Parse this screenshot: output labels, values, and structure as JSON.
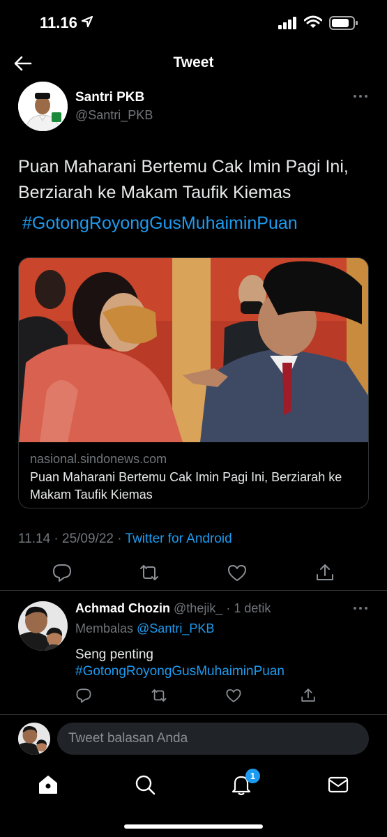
{
  "status_bar": {
    "time": "11.16",
    "icons": [
      "location-arrow-icon",
      "signal-bars-icon",
      "wifi-icon",
      "battery-icon"
    ]
  },
  "header": {
    "title": "Tweet",
    "back_icon": "arrow-left-icon"
  },
  "tweet": {
    "author_name": "Santri PKB",
    "author_handle": "@Santri_PKB",
    "text": "Puan Maharani Bertemu Cak Imin Pagi Ini, Berziarah ke Makam Taufik Kiemas",
    "hashtag": "#GotongRoyongGusMuhaiminPuan",
    "card": {
      "domain": "nasional.sindonews.com",
      "title": "Puan Maharani Bertemu Cak Imin Pagi Ini, Berziarah ke Makam Taufik Kiemas"
    },
    "timestamp": "11.14 · 25/09/22 · ",
    "source": "Twitter for Android",
    "actions": [
      "reply-icon",
      "retweet-icon",
      "like-icon",
      "share-icon"
    ]
  },
  "reply": {
    "author_name": "Achmad Chozin",
    "author_handle": "@thejik_",
    "time": " · 1 detik",
    "replying_prefix": "Membalas ",
    "replying_to": "@Santri_PKB",
    "text": "Seng penting",
    "hashtag": "#GotongRoyongGusMuhaiminPuan"
  },
  "compose": {
    "placeholder": "Tweet balasan Anda"
  },
  "tabbar": {
    "tabs": [
      "home-icon",
      "search-icon",
      "notifications-icon",
      "messages-icon"
    ],
    "notification_count": "1"
  },
  "colors": {
    "background": "#000000",
    "accent": "#1d9bf0",
    "secondary_text": "#71767b",
    "divider": "#2f3336"
  }
}
